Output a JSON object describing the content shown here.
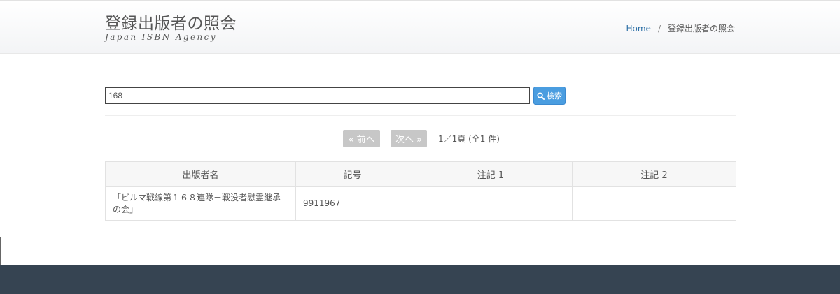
{
  "header": {
    "title": "登録出版者の照会",
    "subtitle": "Japan ISBN Agency"
  },
  "breadcrumb": {
    "home": "Home",
    "separator": "/",
    "current": "登録出版者の照会"
  },
  "search": {
    "value": "168",
    "button_label": "検索",
    "icon": "search-icon"
  },
  "pagination": {
    "prev_label": "« 前へ",
    "next_label": "次へ »",
    "status": "1／1頁 (全1 件)"
  },
  "table": {
    "headers": [
      "出版者名",
      "記号",
      "注記 1",
      "注記 2"
    ],
    "rows": [
      [
        "「ビルマ戦線第１６８連隊－戦没者慰霊継承の会」",
        "9911967",
        "",
        ""
      ]
    ]
  },
  "colors": {
    "accent": "#4a9de0",
    "link": "#2c6fa6",
    "footer": "#364452",
    "disabled_button": "#c7c7c7"
  }
}
